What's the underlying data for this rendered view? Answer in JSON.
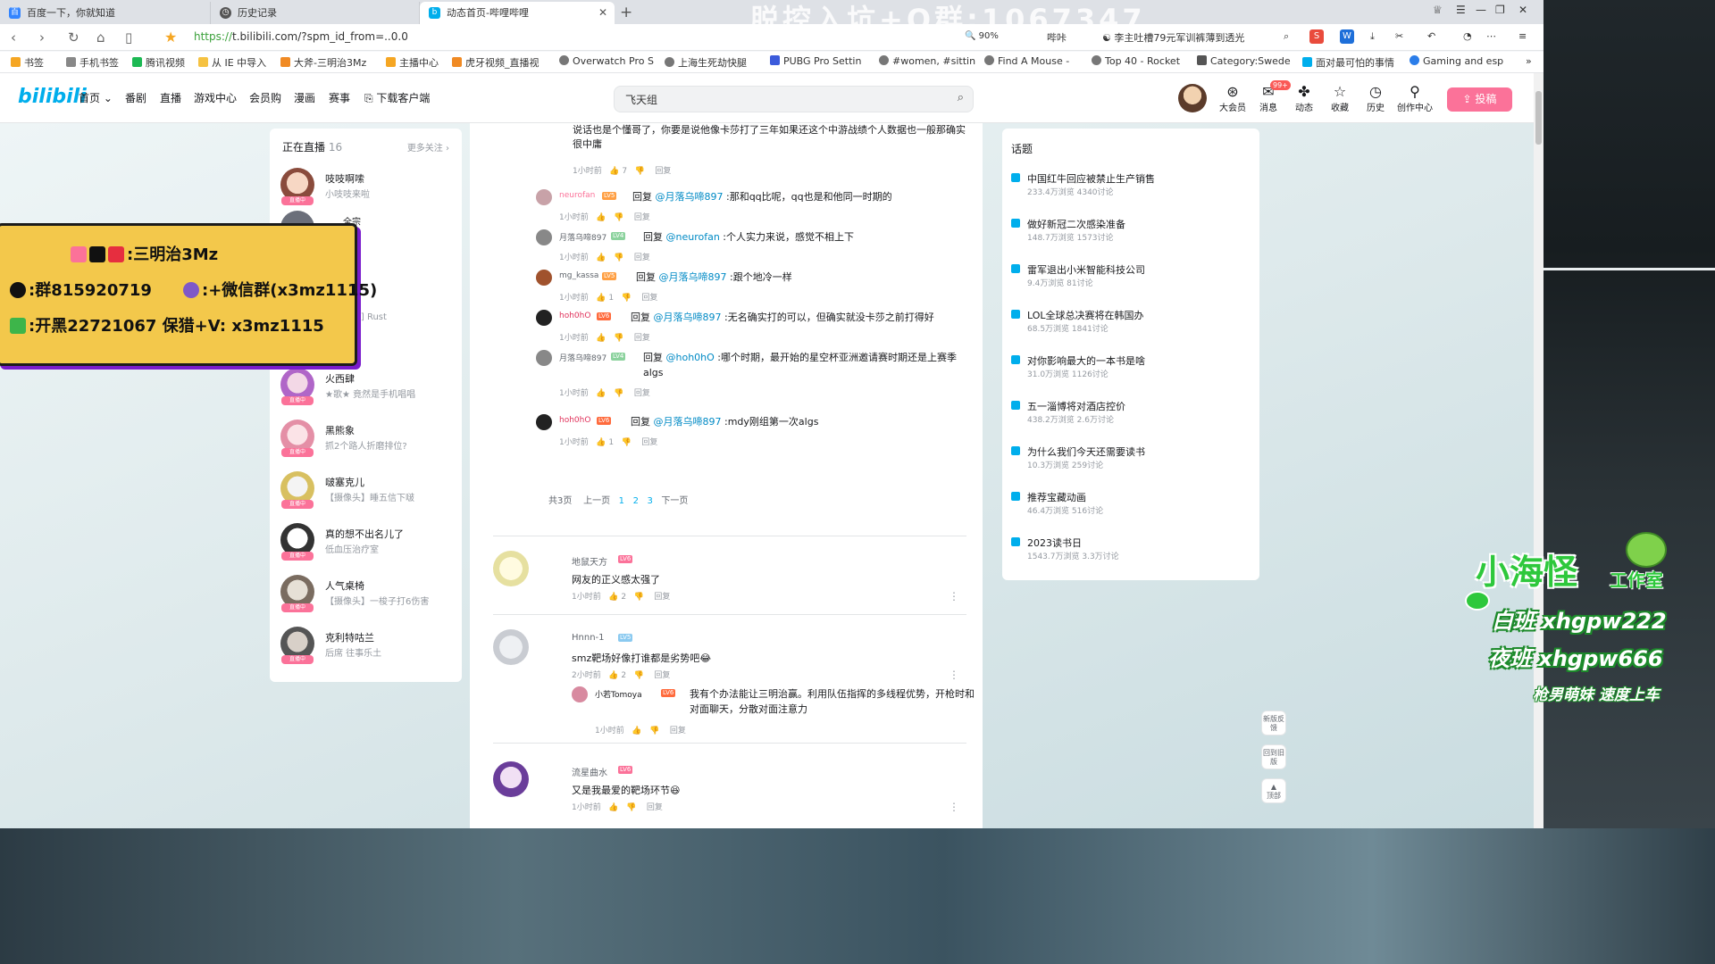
{
  "browser": {
    "tabs": [
      {
        "label": "百度一下，你就知道",
        "icon": "baidu-icon",
        "active": false
      },
      {
        "label": "历史记录",
        "icon": "history-icon",
        "active": false
      },
      {
        "label": "动态首页-哔哩哔哩",
        "icon": "bilibili-icon",
        "active": true
      }
    ],
    "new_tab": "+",
    "overlay_title": "脱控入坑+Q群:1067347",
    "url_scheme": "https://",
    "url_rest": "t.bilibili.com/?spm_id_from=..0.0",
    "zoom": "90%",
    "addr_items": [
      "哔咔",
      "李主吐槽79元军训裤薄到透光"
    ],
    "bookmarks": [
      "书签",
      "手机书签",
      "腾讯视频",
      "从 IE 中导入",
      "大斧-三明治3Mz",
      "主播中心",
      "虎牙视频_直播视",
      "Overwatch Pro S",
      "上海生死劫快腿",
      "PUBG Pro Settin",
      "#women, #sittin",
      "Find A Mouse -",
      "Top 40 - Rocket",
      "Category:Swede",
      "面对最可怕的事情",
      "Gaming and esp"
    ]
  },
  "header": {
    "logo": "bilibili",
    "nav": [
      "首页",
      "番剧",
      "直播",
      "游戏中心",
      "会员购",
      "漫画",
      "赛事",
      "下载客户端"
    ],
    "search_value": "飞天组",
    "right": [
      {
        "label": "大会员",
        "icon": "vip-icon"
      },
      {
        "label": "消息",
        "icon": "message-icon",
        "badge": "99+"
      },
      {
        "label": "动态",
        "icon": "dynamic-icon"
      },
      {
        "label": "收藏",
        "icon": "star-icon"
      },
      {
        "label": "历史",
        "icon": "clock-icon"
      },
      {
        "label": "创作中心",
        "icon": "bulb-icon"
      }
    ],
    "upload": "投稿"
  },
  "live": {
    "title": "正在直播",
    "count": "16",
    "more": "更多关注 ›",
    "tag": "直播中",
    "items": [
      {
        "name": "吱吱啊嗦",
        "sub": "小吱吱来啦"
      },
      {
        "name": "",
        "sub": "全宗"
      },
      {
        "name": "",
        "sub": "子"
      },
      {
        "name": "",
        "sub": "ma] Rust"
      },
      {
        "name": "火西肆",
        "sub": "★歌★ 竟然是手机唱唱"
      },
      {
        "name": "黑熊象",
        "sub": "抓2个路人折磨排位?"
      },
      {
        "name": "啵塞克儿",
        "sub": "【摄像头】睡五信下啵"
      },
      {
        "name": "真的想不出名儿了",
        "sub": "低血压治疗室"
      },
      {
        "name": "人气桌椅",
        "sub": "【摄像头】一梭子打6伤害"
      },
      {
        "name": "克利特咕兰",
        "sub": "后席 往事乐土"
      }
    ]
  },
  "feed": {
    "top_text": "说话也是个懂哥了，你要是说他像卡莎打了三年如果还这个中游战绩个人数据也一般那确实很中庸",
    "top_meta": {
      "time": "1小时前",
      "likes": "7",
      "reply": "回复"
    },
    "replies": [
      {
        "name": "neurofan",
        "level": "LV5",
        "text_prefix": "回复 ",
        "at": "@月落乌啼897",
        "text": " :那和qq比呢，qq也是和他同一时期的",
        "time": "1小时前",
        "likes": "",
        "reply": "回复"
      },
      {
        "name": "月落乌啼897",
        "level": "LV4",
        "text_prefix": "回复 ",
        "at": "@neurofan",
        "text": " :个人实力来说，感觉不相上下",
        "time": "1小时前",
        "likes": "",
        "reply": "回复"
      },
      {
        "name": "mg_kassa",
        "level": "LV5",
        "text_prefix": "回复 ",
        "at": "@月落乌啼897",
        "text": " :跟个地冷一样",
        "time": "1小时前",
        "likes": "1",
        "reply": "回复"
      },
      {
        "name": "hoh0hO",
        "level": "LV6",
        "text_prefix": "回复 ",
        "at": "@月落乌啼897",
        "text": " :无名确实打的可以，但确实就没卡莎之前打得好",
        "time": "1小时前",
        "likes": "",
        "reply": "回复"
      },
      {
        "name": "月落乌啼897",
        "level": "LV4",
        "text_prefix": "回复 ",
        "at": "@hoh0hO",
        "text": " :哪个时期，最开始的星空杯亚洲邀请赛时期还是上赛季algs",
        "time": "1小时前",
        "likes": "",
        "reply": "回复"
      },
      {
        "name": "hoh0hO",
        "level": "LV6",
        "text_prefix": "回复 ",
        "at": "@月落乌啼897",
        "text": " :mdy刚组第一次algs",
        "time": "1小时前",
        "likes": "1",
        "reply": "回复"
      }
    ],
    "pager": {
      "total": "共3页",
      "prev": "上一页",
      "pages": [
        "1",
        "2",
        "3"
      ],
      "next": "下一页"
    },
    "comments": [
      {
        "name": "地鼠天方",
        "level": "LV6",
        "text": "网友的正义感太强了",
        "time": "1小时前",
        "likes": "2",
        "reply": "回复"
      },
      {
        "name": "Hnnn-1",
        "level": "LV5",
        "text": "smz靶场好像打谁都是劣势吧😂",
        "time": "2小时前",
        "likes": "2",
        "reply": "回复",
        "sub": {
          "name": "小若Tomoya",
          "level": "LV6",
          "text": "我有个办法能让三明治赢。利用队伍指挥的多线程优势，开枪时和对面聊天，分散对面注意力",
          "time": "1小时前",
          "reply": "回复"
        }
      },
      {
        "name": "流星曲水",
        "level": "LV6",
        "text": "又是我最爱的靶场环节😆",
        "time": "1小时前",
        "likes": "",
        "reply": "回复"
      }
    ]
  },
  "topics": {
    "title": "话题",
    "items": [
      {
        "name": "中国红牛回应被禁止生产销售",
        "stat": "233.4万浏览 4340讨论"
      },
      {
        "name": "做好新冠二次感染准备",
        "stat": "148.7万浏览 1573讨论"
      },
      {
        "name": "雷军退出小米智能科技公司",
        "stat": "9.4万浏览 81讨论"
      },
      {
        "name": "LOL全球总决赛将在韩国办",
        "stat": "68.5万浏览 1841讨论"
      },
      {
        "name": "对你影响最大的一本书是啥",
        "stat": "31.0万浏览 1126讨论"
      },
      {
        "name": "五一淄博将对酒店控价",
        "stat": "438.2万浏览 2.6万讨论"
      },
      {
        "name": "为什么我们今天还需要读书",
        "stat": "10.3万浏览 259讨论"
      },
      {
        "name": "推荐宝藏动画",
        "stat": "46.4万浏览 516讨论"
      },
      {
        "name": "2023读书日",
        "stat": "1543.7万浏览 3.3万讨论"
      }
    ]
  },
  "float_buttons": [
    "新版反馈",
    "回到旧版",
    "顶部"
  ],
  "promo": {
    "line1": ":三明治3Mz",
    "line2a": ":群815920719",
    "line2b": ":+微信群(x3mz1115)",
    "line3": ":开黑22721067  保猎+V: x3mz1115"
  },
  "studio": {
    "title": "小海怪",
    "subtitle": "工作室",
    "day": "白班 xhgpw222",
    "night": "夜班 xhgpw666",
    "tag": "枪男萌妹 速度上车"
  },
  "colors": {
    "bili_blue": "#00aeec",
    "bili_pink": "#fb7299",
    "promo_yellow": "#f3c84b",
    "studio_green": "#2ec83c"
  }
}
